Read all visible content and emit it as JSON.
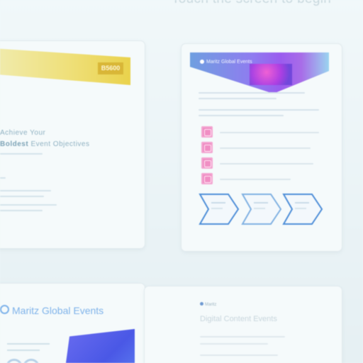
{
  "headline": "Touch the screen to begin",
  "card_1": {
    "tag": "B5600",
    "line_1": "Achieve Your",
    "line_2_bold": "Boldest",
    "line_2_rest": " Event Objectives"
  },
  "card_2": {
    "brand": "Maritz Global Events"
  },
  "card_3": {
    "brand": "Maritz Global Events"
  },
  "card_4": {
    "brand": "Maritz",
    "title": "Digital Content Events"
  },
  "colors": {
    "background": "#edf5f8",
    "accent_yellow": "#ead24c",
    "accent_purple": "#9a5cef",
    "accent_pink": "#f08ec4",
    "accent_blue": "#4a58e6",
    "chevron_stroke": "#4f8fd8"
  }
}
